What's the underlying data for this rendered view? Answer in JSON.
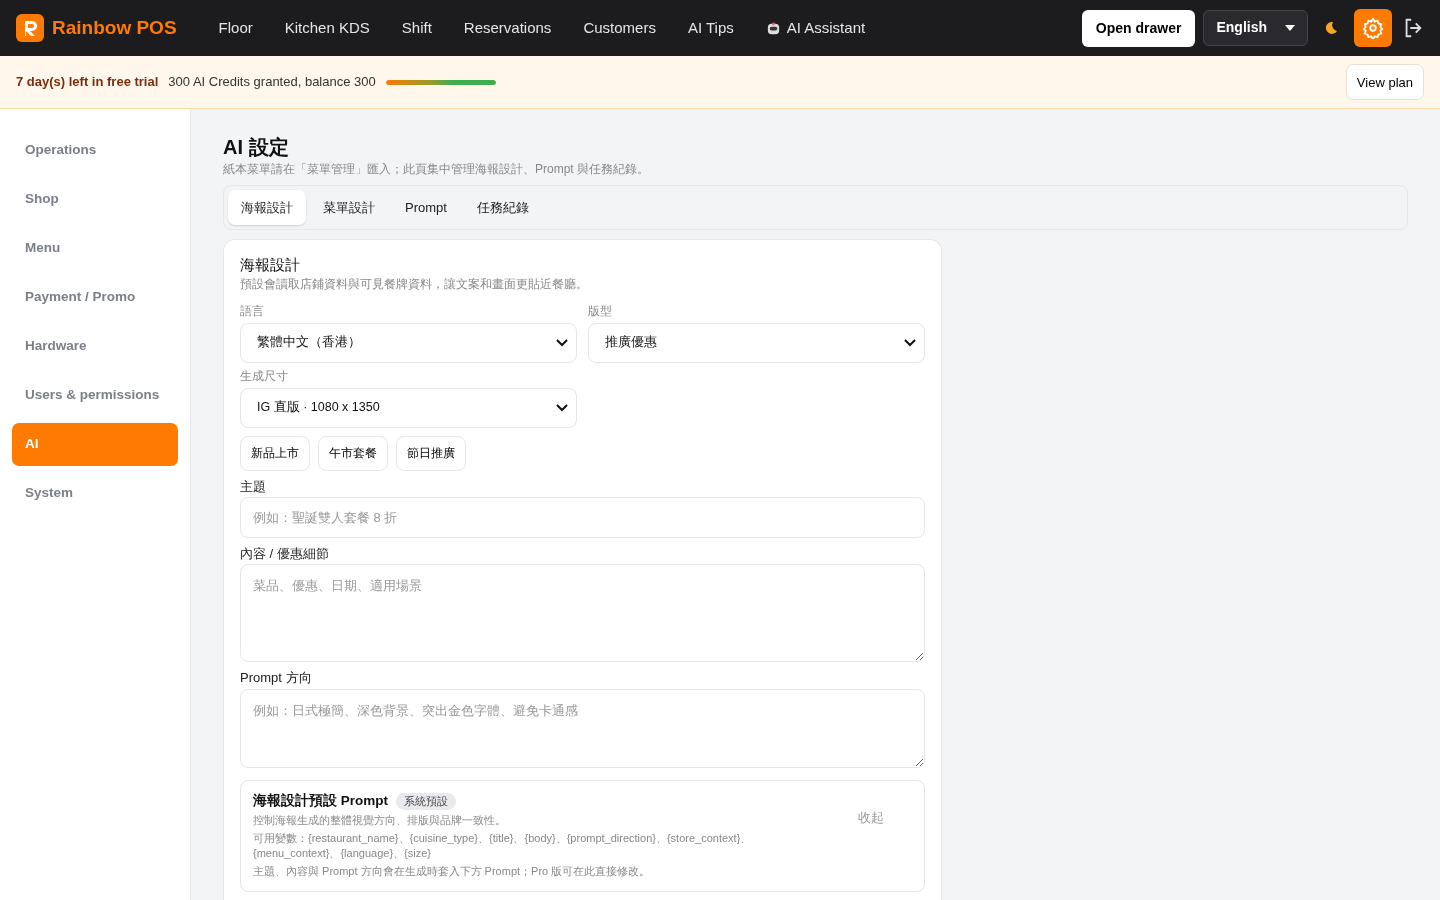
{
  "topbar": {
    "brand": "Rainbow POS",
    "nav": [
      {
        "label": "Floor",
        "kind": "link"
      },
      {
        "label": "Kitchen KDS",
        "kind": "link"
      },
      {
        "label": "Shift",
        "kind": "link"
      },
      {
        "label": "Reservations",
        "kind": "link"
      },
      {
        "label": "Customers",
        "kind": "link"
      },
      {
        "label": "AI Tips",
        "kind": "link"
      },
      {
        "label": "AI Assistant",
        "kind": "assistant"
      }
    ],
    "open_drawer": "Open drawer",
    "language": "English",
    "settings_active": true
  },
  "trial": {
    "days_left": "7 day(s) left in free trial",
    "credits": "300 AI Credits granted, balance 300",
    "level": 1,
    "view_plan": "View plan"
  },
  "sidebar": {
    "items": [
      {
        "label": "Operations",
        "selected": false
      },
      {
        "label": "Shop",
        "selected": false
      },
      {
        "label": "Menu",
        "selected": false
      },
      {
        "label": "Payment / Promo",
        "selected": false
      },
      {
        "label": "Hardware",
        "selected": false
      },
      {
        "label": "Users & permissions",
        "selected": false
      },
      {
        "label": "AI",
        "selected": true
      },
      {
        "label": "System",
        "selected": false
      }
    ]
  },
  "page": {
    "title": "AI 設定",
    "subtitle": "紙本菜單請在「菜單管理」匯入；此頁集中管理海報設計、Prompt 與任務紀錄。",
    "tabs": [
      {
        "label": "海報設計",
        "selected": true
      },
      {
        "label": "菜單設計",
        "selected": false
      },
      {
        "label": "Prompt",
        "selected": false
      },
      {
        "label": "任務紀錄",
        "selected": false
      }
    ]
  },
  "poster": {
    "title": "海報設計",
    "description": "預設會讀取店鋪資料與可見餐牌資料，讓文案和畫面更貼近餐廳。",
    "language": {
      "label": "語言",
      "value": "繁體中文（香港）"
    },
    "layout": {
      "label": "版型",
      "value": "推廣優惠"
    },
    "size": {
      "label": "生成尺寸",
      "value": "IG 直版 · 1080 x 1350"
    },
    "presets": [
      "新品上市",
      "午市套餐",
      "節日推廣"
    ],
    "subject": {
      "label": "主題",
      "placeholder": "例如：聖誕雙人套餐 8 折"
    },
    "content": {
      "label": "內容 / 優惠細節",
      "placeholder": "菜品、優惠、日期、適用場景"
    },
    "direction": {
      "label": "Prompt 方向",
      "placeholder": "例如：日式極簡、深色背景、突出金色字體、避免卡通感"
    },
    "prompt_panel": {
      "title": "海報設計預設 Prompt",
      "badge": "系統預設",
      "collapse": "收起",
      "lines": [
        "控制海報生成的整體視覺方向、排版與品牌一致性。",
        "可用變數：{restaurant_name}、{cuisine_type}、{title}、{body}、{prompt_direction}、{store_context}、{menu_context}、{language}、{size}",
        "主題、內容與 Prompt 方向會在生成時套入下方 Prompt；Pro 版可在此直接修改。"
      ]
    }
  }
}
